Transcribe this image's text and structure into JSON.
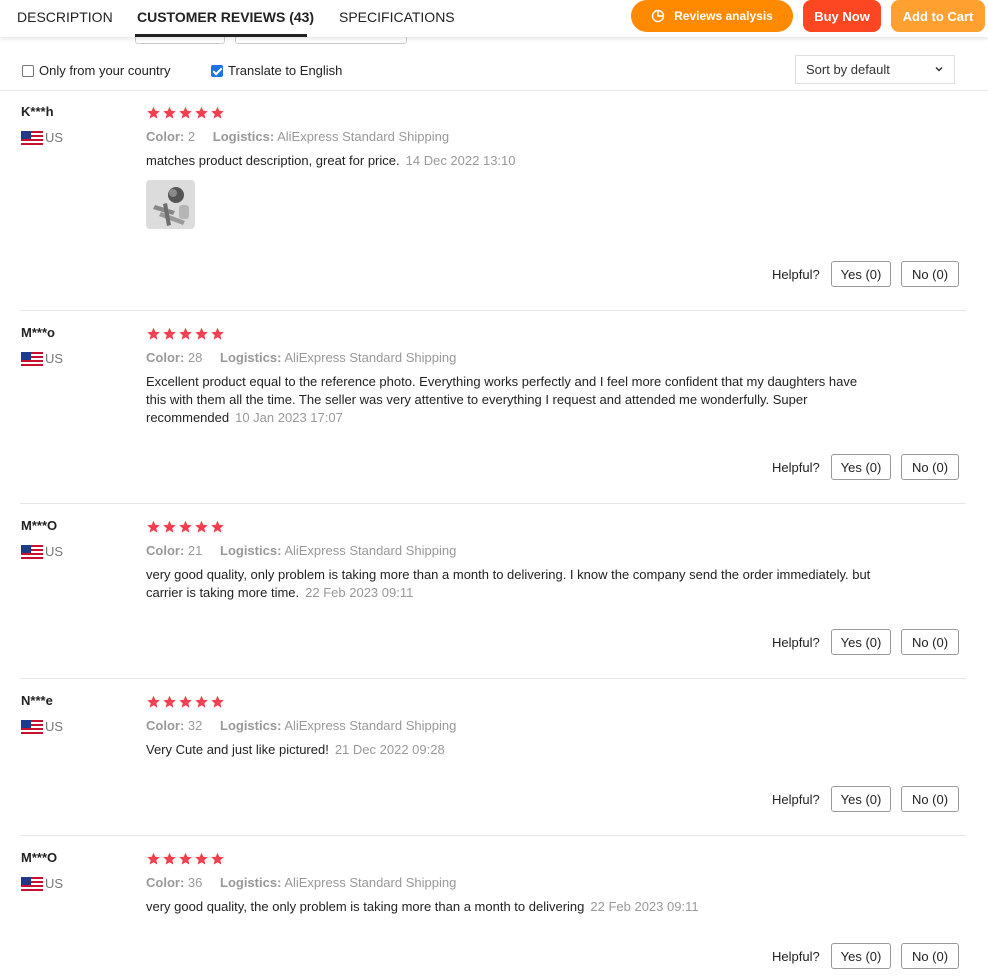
{
  "tabs": [
    {
      "label": "DESCRIPTION"
    },
    {
      "label": "CUSTOMER REVIEWS (43)"
    },
    {
      "label": "SPECIFICATIONS"
    }
  ],
  "actions": {
    "analysis_label": "Reviews analysis",
    "buy_label": "Buy Now",
    "cart_label": "Add to Cart"
  },
  "filters": {
    "only_country_label": "Only from your country",
    "only_country_checked": false,
    "translate_label": "Translate to English",
    "translate_checked": true,
    "sort_value": "Sort by default"
  },
  "labels": {
    "color": "Color:",
    "logistics": "Logistics:",
    "helpful": "Helpful?"
  },
  "colors": {
    "star": "#f0424e",
    "analysis": "#ff8a00",
    "buy": "#fd4622",
    "cart": "#ffa030"
  },
  "reviews": [
    {
      "name": "K***h",
      "country": "US",
      "rating": 5,
      "color": "2",
      "logistics": "AliExpress Standard Shipping",
      "text": "matches product description, great for price.",
      "date": "14 Dec 2022 13:10",
      "has_photo": true,
      "yes": "Yes (0)",
      "no": "No (0)"
    },
    {
      "name": "M***o",
      "country": "US",
      "rating": 5,
      "color": "28",
      "logistics": "AliExpress Standard Shipping",
      "text": "Excellent product equal to the reference photo. Everything works perfectly and I feel more confident that my daughters have this with them all the time. The seller was very attentive to everything I request and attended me wonderfully. Super recommended",
      "date": "10 Jan 2023 17:07",
      "has_photo": false,
      "yes": "Yes (0)",
      "no": "No (0)"
    },
    {
      "name": "M***O",
      "country": "US",
      "rating": 5,
      "color": "21",
      "logistics": "AliExpress Standard Shipping",
      "text": "very good quality, only problem is taking more than a month to delivering. I know the company send the order immediately. but carrier is taking more time.",
      "date": "22 Feb 2023 09:11",
      "has_photo": false,
      "yes": "Yes (0)",
      "no": "No (0)"
    },
    {
      "name": "N***e",
      "country": "US",
      "rating": 5,
      "color": "32",
      "logistics": "AliExpress Standard Shipping",
      "text": "Very Cute and just like pictured!",
      "date": "21 Dec 2022 09:28",
      "has_photo": false,
      "yes": "Yes (0)",
      "no": "No (0)"
    },
    {
      "name": "M***O",
      "country": "US",
      "rating": 5,
      "color": "36",
      "logistics": "AliExpress Standard Shipping",
      "text": "very good quality, the only problem is taking more than a month to delivering",
      "date": "22 Feb 2023 09:11",
      "has_photo": false,
      "yes": "Yes (0)",
      "no": "No (0)"
    }
  ]
}
